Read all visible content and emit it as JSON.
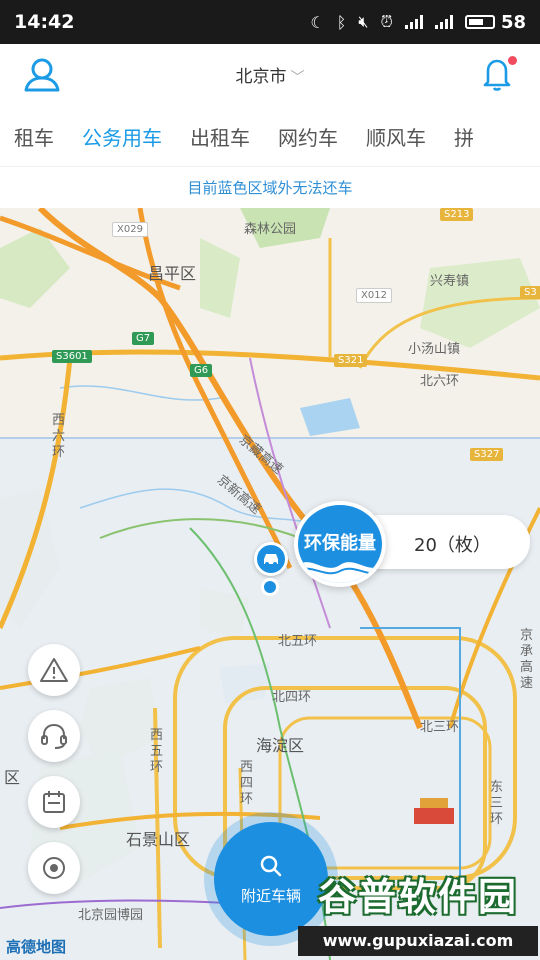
{
  "status_bar": {
    "time": "14:42",
    "battery": "58",
    "icons": [
      "moon-icon",
      "bluetooth-icon",
      "mute-icon",
      "alarm-icon",
      "signal-icon",
      "signal-icon",
      "battery-icon"
    ]
  },
  "header": {
    "city": "北京市",
    "user_icon": "user-icon",
    "bell_icon": "bell-icon",
    "accent": "#1b9be6"
  },
  "tabs": [
    {
      "label": "租车",
      "active": false
    },
    {
      "label": "公务用车",
      "active": true
    },
    {
      "label": "出租车",
      "active": false
    },
    {
      "label": "网约车",
      "active": false
    },
    {
      "label": "顺风车",
      "active": false
    },
    {
      "label": "拼",
      "active": false
    }
  ],
  "notice": "目前蓝色区域外无法还车",
  "map": {
    "labels": {
      "changping": "昌平区",
      "forest_park": "森林公园",
      "xingshou": "兴寿镇",
      "xiaotangshan": "小汤山镇",
      "beiliuhuan": "北六环",
      "xiliuhuan": "西六环",
      "jingzang1": "京藏高速",
      "jingzang2": "京新高速",
      "beiwuhuan": "北五环",
      "beisihuan": "北四环",
      "beisanhuan": "北三环",
      "xiwuhuan": "西五环",
      "xisihuan": "西四环",
      "haidian": "海淀区",
      "shijingshan": "石景山区",
      "dongsanhuan": "东三环",
      "yuanboyuan": "北京园博园",
      "jingcheng": "京承高速",
      "qu": "区"
    },
    "road_badges": {
      "x029": "X029",
      "s213": "S213",
      "x012": "X012",
      "s3": "S3",
      "g7": "G7",
      "s3601": "S3601",
      "g6": "G6",
      "s321": "S321",
      "s327": "S327"
    },
    "logo": "高德地图"
  },
  "energy": {
    "label": "环保能量",
    "value": "20（枚）"
  },
  "side_buttons": [
    "warning-icon",
    "headset-icon",
    "calendar-icon",
    "eye-icon"
  ],
  "nearby": {
    "label": "附近车辆"
  },
  "watermark": {
    "title": "谷普软件园",
    "url": "www.gupuxiazai.com"
  }
}
